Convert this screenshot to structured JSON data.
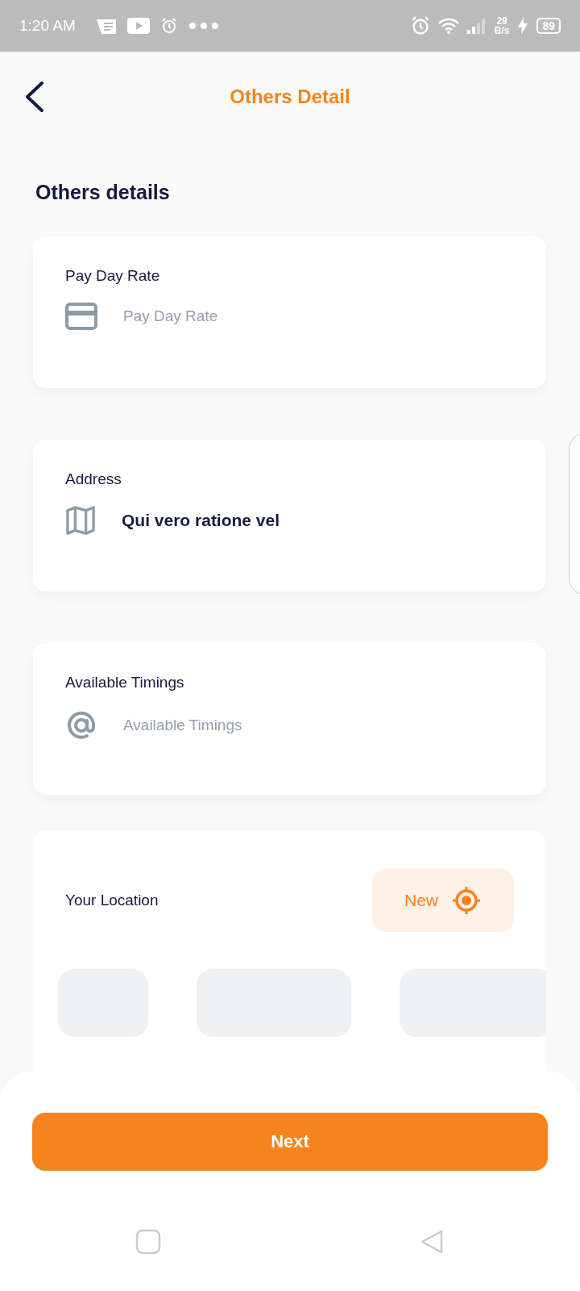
{
  "status_bar": {
    "time": "1:20 AM",
    "net_speed": "29",
    "net_unit": "B/s",
    "battery": "89"
  },
  "header": {
    "title": "Others Detail"
  },
  "section_title": "Others details",
  "fields": [
    {
      "label": "Pay Day Rate",
      "kind": "card",
      "placeholder": "Pay Day Rate"
    },
    {
      "label": "Address",
      "kind": "map",
      "value": "Qui vero ratione vel"
    },
    {
      "label": "Available Timings",
      "kind": "at",
      "placeholder": "Available Timings"
    }
  ],
  "location": {
    "label": "Your Location",
    "button": "New"
  },
  "next_button": "Next"
}
